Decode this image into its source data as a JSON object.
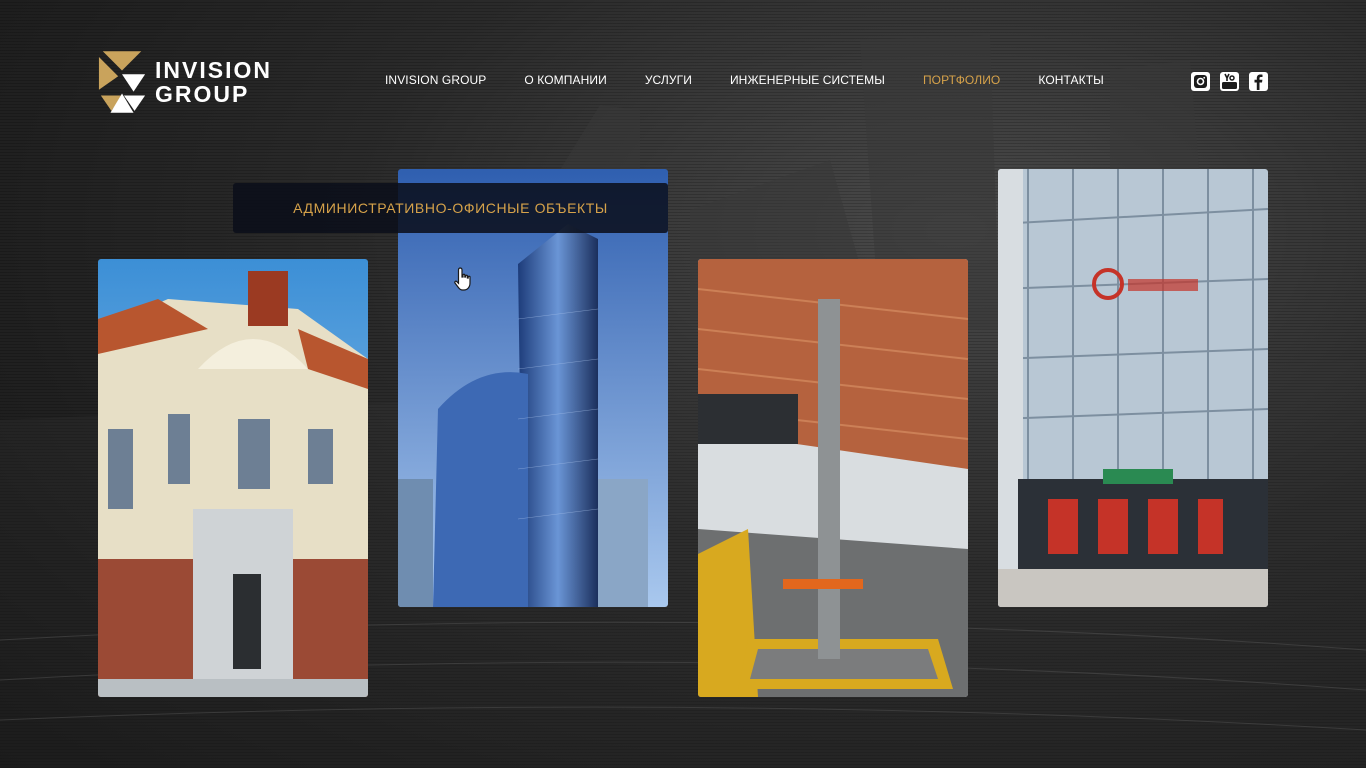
{
  "brand": {
    "line1": "INVISION",
    "line2": "GROUP"
  },
  "nav": [
    {
      "label": "INVISION GROUP",
      "active": false
    },
    {
      "label": "О КОМПАНИИ",
      "active": false
    },
    {
      "label": "УСЛУГИ",
      "active": false
    },
    {
      "label": "ИНЖЕНЕРНЫЕ СИСТЕМЫ",
      "active": false
    },
    {
      "label": "ПОРТФОЛИО",
      "active": true
    },
    {
      "label": "КОНТАКТЫ",
      "active": false
    }
  ],
  "social": [
    "instagram-icon",
    "youtube-icon",
    "facebook-icon"
  ],
  "portfolio": {
    "hover_caption": "АДМИНИСТРАТИВНО-ОФИСНЫЕ ОБЪЕКТЫ",
    "cards": [
      "residential-house",
      "skyscraper-towers",
      "railway-station-platform",
      "metro-station-entrance"
    ]
  },
  "colors": {
    "accent": "#d6a24a",
    "caption_bg": "#0a0e1a",
    "text": "#ffffff"
  }
}
